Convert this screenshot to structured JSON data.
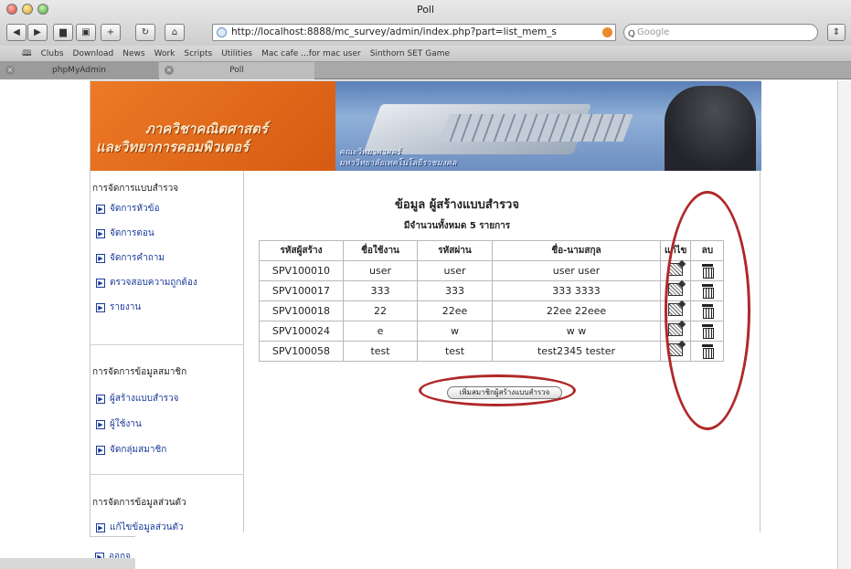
{
  "window": {
    "title": "Poll"
  },
  "toolbar": {
    "url": "http://localhost:8888/mc_survey/admin/index.php?part=list_mem_s",
    "search_placeholder": "Google"
  },
  "bookmarks": [
    "Clubs",
    "Download",
    "News",
    "Work",
    "Scripts",
    "Utilities",
    "Mac cafe ...for mac user",
    "Sinthorn SET Game"
  ],
  "tabs": [
    {
      "label": "phpMyAdmin"
    },
    {
      "label": "Poll"
    }
  ],
  "banner": {
    "title_line1": "ภาควิชาคณิตศาสตร์",
    "title_line2": "และวิทยาการคอมพิวเตอร์",
    "sub_line1": "คณะวิทยาศาสตร์",
    "sub_line2": "มหาวิทยาลัยเทคโนโลยีราชมงคล"
  },
  "sidebar": {
    "sections": [
      {
        "heading": "การจัดการแบบสำรวจ",
        "items": [
          "จัดการหัวข้อ",
          "จัดการตอน",
          "จัดการคำถาม",
          "ตรวจสอบความถูกต้อง",
          "รายงาน"
        ]
      },
      {
        "heading": "การจัดการข้อมูลสมาชิก",
        "items": [
          "ผู้สร้างแบบสำรวจ",
          "ผู้ใช้งาน",
          "จัดกลุ่มสมาชิก"
        ]
      },
      {
        "heading": "การจัดการข้อมูลส่วนตัว",
        "items": [
          "แก้ไขข้อมูลส่วนตัว",
          "ออกจ"
        ]
      }
    ]
  },
  "main": {
    "title": "ข้อมูล ผู้สร้างแบบสำรวจ",
    "count_text": "มีจำนวนทั้งหมด 5 รายการ",
    "columns": [
      "รหัสผู้สร้าง",
      "ชื่อใช้งาน",
      "รหัสผ่าน",
      "ชื่อ-นามสกุล",
      "แก้ไข",
      "ลบ"
    ],
    "rows": [
      [
        "SPV100010",
        "user",
        "user",
        "user  user"
      ],
      [
        "SPV100017",
        "333",
        "333",
        "333  3333"
      ],
      [
        "SPV100018",
        "22",
        "22ee",
        "22ee  22eee"
      ],
      [
        "SPV100024",
        "e",
        "w",
        "w  w"
      ],
      [
        "SPV100058",
        "test",
        "test",
        "test2345  tester"
      ]
    ],
    "add_button_label": "เพิ่มสมาชิกผู้สร้างแบบสำรวจ"
  },
  "colors": {
    "annotation_ring": "#b02828",
    "banner_orange": "#e46b1c",
    "link_blue": "#1a3a9a"
  }
}
